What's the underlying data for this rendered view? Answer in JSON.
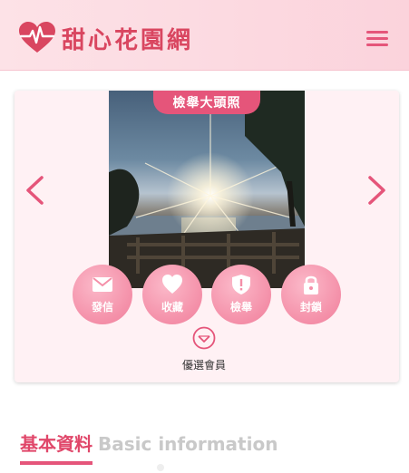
{
  "header": {
    "logo_text": "甜心花園網",
    "brand_color": "#d94660",
    "menu_icon": "hamburger-menu-icon"
  },
  "profile": {
    "report_photo_label": "檢舉大頭照",
    "prev_icon": "chevron-left-icon",
    "next_icon": "chevron-right-icon",
    "actions": [
      {
        "icon": "envelope-icon",
        "label": "發信"
      },
      {
        "icon": "heart-icon",
        "label": "收藏"
      },
      {
        "icon": "shield-alert-icon",
        "label": "檢舉"
      },
      {
        "icon": "lock-icon",
        "label": "封鎖"
      }
    ],
    "vip_icon": "diamond-icon",
    "vip_label": "優選會員"
  },
  "section": {
    "title_zh": "基本資料",
    "title_en": "Basic information"
  },
  "colors": {
    "accent": "#e5557a",
    "header_bg": "#fde2e7",
    "card_bg": "#fff1f4",
    "action_bg": "#f48fa8"
  }
}
